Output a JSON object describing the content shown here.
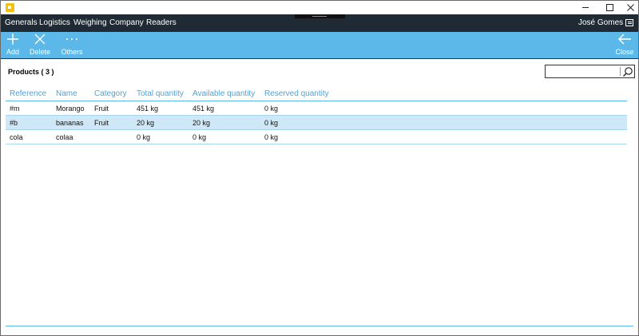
{
  "window": {
    "app_icon": "app-logo-icon",
    "buttons": [
      "minimize-icon",
      "maximize-icon",
      "close-icon"
    ]
  },
  "menu": {
    "items": [
      "Generals",
      "Logistics",
      "Weighing",
      "Company",
      "Readers"
    ],
    "user": "José Gomes",
    "notifications_icon": "chat-icon"
  },
  "commands": {
    "add": {
      "label": "Add",
      "icon": "plus-icon"
    },
    "delete": {
      "label": "Delete",
      "icon": "x-icon"
    },
    "others": {
      "label": "Others",
      "icon": "ellipsis-icon"
    },
    "close": {
      "label": "Close",
      "icon": "back-arrow-icon"
    }
  },
  "products": {
    "title": "Products ( 3 )",
    "search_value": "",
    "columns": [
      "Reference",
      "Name",
      "Category",
      "Total quantity",
      "Available quantity",
      "Reserved quantity"
    ],
    "rows": [
      {
        "reference": "#m",
        "name": "Morango",
        "category": "Fruit",
        "total": "451 kg",
        "available": "451 kg",
        "reserved": "0 kg"
      },
      {
        "reference": "#b",
        "name": "bananas",
        "category": "Fruit",
        "total": "20 kg",
        "available": "20 kg",
        "reserved": "0 kg",
        "selected": true
      },
      {
        "reference": "cola",
        "name": "colaa",
        "category": "",
        "total": "0 kg",
        "available": "0 kg",
        "reserved": "0 kg"
      }
    ]
  },
  "colors": {
    "accent": "#5bb8e9",
    "menu_bg": "#1f2a35",
    "header_text": "#4fa3d9",
    "selected_row": "#cfe8f7"
  }
}
